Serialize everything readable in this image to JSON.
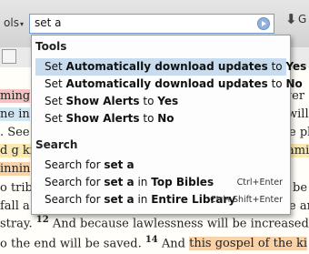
{
  "toolbar": {
    "left_label": "ols",
    "left_chevron": "▾",
    "search_value": "set a",
    "go_icon": "go-arrow-icon",
    "download_icon": "download-arrow-icon",
    "right_label": "G"
  },
  "dropdown": {
    "sections": [
      {
        "title": "Tools",
        "items": [
          {
            "parts": [
              "Set ",
              "Automatically download updates",
              " to ",
              "Yes",
              ""
            ],
            "selected": true
          },
          {
            "parts": [
              "Set ",
              "Automatically download updates",
              " to ",
              "No",
              ""
            ],
            "selected": false
          },
          {
            "parts": [
              "Set ",
              "Show Alerts",
              " to ",
              "Yes",
              ""
            ],
            "selected": false
          },
          {
            "parts": [
              "Set ",
              "Show Alerts",
              " to ",
              "No",
              ""
            ],
            "selected": false
          }
        ]
      },
      {
        "title": "Search",
        "items": [
          {
            "parts": [
              "Search for ",
              "set a",
              "",
              "",
              ""
            ],
            "shortcut": "",
            "selected": false
          },
          {
            "parts": [
              "Search for ",
              "set a",
              " in ",
              "Top Bibles",
              ""
            ],
            "shortcut": "Ctrl+Enter",
            "selected": false
          },
          {
            "parts": [
              "Search for ",
              "set a",
              " in ",
              "Entire Library",
              ""
            ],
            "shortcut": "Ctrl+Shift+Enter",
            "selected": false
          }
        ]
      }
    ]
  },
  "reading": {
    "line1_left": "ming",
    "line1_right": "wer",
    "line2_left": "ne in",
    "line2_right": "will l",
    "line3_left": ". See",
    "line3_right": "e pla",
    "line4_left": "d g ki",
    "line4_right": "ami",
    "line5_left": "innin",
    "line6_left": "o trib",
    "line6_right": "be",
    "line7_left": "fall a",
    "line7_right": "e ar",
    "line8_text": "stray.",
    "line8_vnum": "12",
    "line8_rest": "And because lawlessness will be increased,",
    "line8_tail": "q",
    "line9_text": "o the end will be saved.",
    "line9_vnum": "14",
    "line9_rest": "And",
    "line9_hl": "this gospel of the ki"
  }
}
